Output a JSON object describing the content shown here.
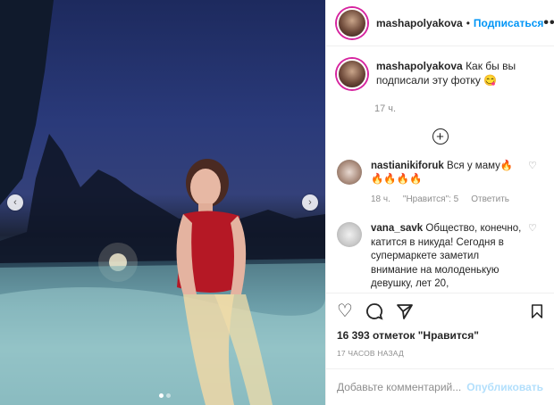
{
  "header": {
    "username": "mashapolyakova",
    "separator": "•",
    "follow_label": "Подписаться",
    "more_label": "•••"
  },
  "caption": {
    "username": "mashapolyakova",
    "text": "Как бы вы подписали эту фотку 😋",
    "time": "17 ч."
  },
  "load_more_label": "+",
  "comments": [
    {
      "username": "nastianikiforuk",
      "text": "Вся у маму🔥🔥🔥🔥🔥",
      "time": "18 ч.",
      "likes": "\"Нравится\": 5",
      "reply": "Ответить"
    },
    {
      "username": "vana_savk",
      "text": "Общество, конечно, катится в никуда! Сегодня в супермаркете заметил внимание на молоденькую девушку, лет 20, привлекательной внешности,",
      "time": "",
      "likes": "",
      "reply": ""
    }
  ],
  "likes_text": "16 393 отметок \"Нравится\"",
  "posted_ago": "17 ЧАСОВ НАЗАД",
  "add_comment": {
    "placeholder": "Добавьте комментарий...",
    "publish_label": "Опубликовать"
  },
  "carousel": {
    "prev": "‹",
    "next": "›",
    "slide_count": 2,
    "active_index": 0
  },
  "colors": {
    "accent": "#0095f6",
    "muted": "#8e8e8e",
    "publish_disabled": "#b2dffc"
  }
}
